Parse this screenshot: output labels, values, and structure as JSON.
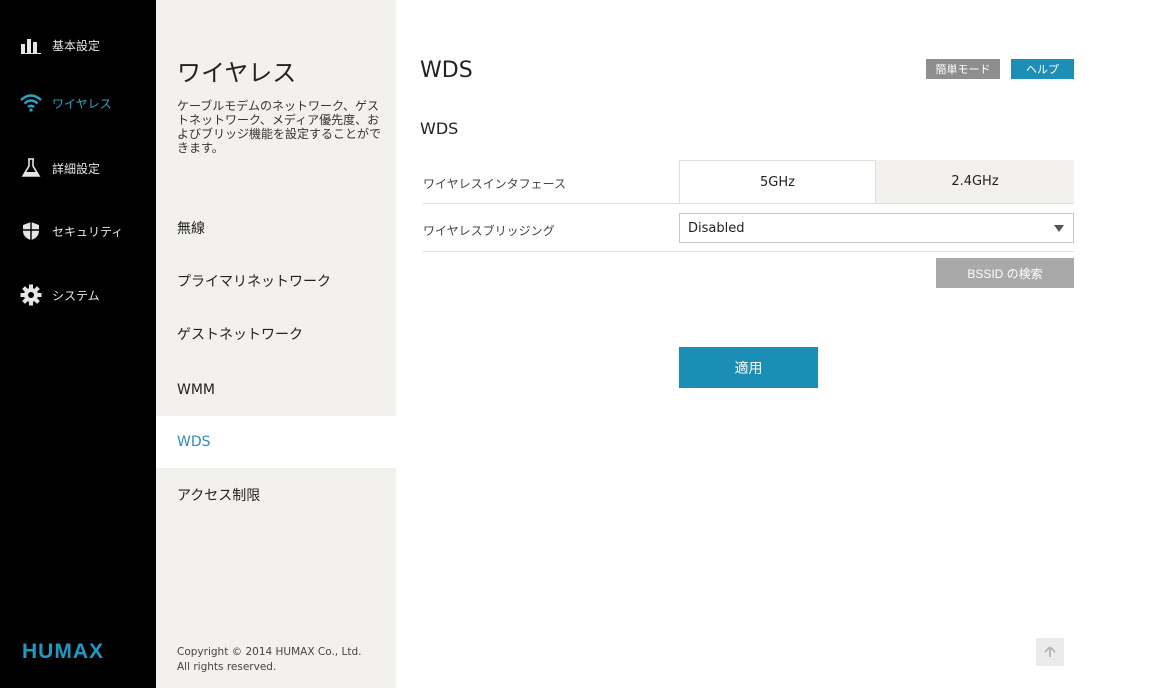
{
  "nav": {
    "items": [
      {
        "label": "基本設定",
        "icon": "bar-chart-icon",
        "active": false
      },
      {
        "label": "ワイヤレス",
        "icon": "wifi-icon",
        "active": true
      },
      {
        "label": "詳細設定",
        "icon": "flask-icon",
        "active": false
      },
      {
        "label": "セキュリティ",
        "icon": "shield-icon",
        "active": false
      },
      {
        "label": "システム",
        "icon": "gear-icon",
        "active": false
      }
    ],
    "logo": "HUMAX"
  },
  "submenu": {
    "title": "ワイヤレス",
    "description": "ケーブルモデムのネットワーク、ゲストネットワーク、メディア優先度、およびブリッジ機能を設定することができます。",
    "items": [
      {
        "label": "無線",
        "active": false
      },
      {
        "label": "プライマリネットワーク",
        "active": false
      },
      {
        "label": "ゲストネットワーク",
        "active": false
      },
      {
        "label": "WMM",
        "active": false
      },
      {
        "label": "WDS",
        "active": true
      },
      {
        "label": "アクセス制限",
        "active": false
      }
    ],
    "copyright_line1": "Copyright © 2014 HUMAX Co., Ltd.",
    "copyright_line2": "All rights reserved."
  },
  "main": {
    "title": "WDS",
    "simple_mode_label": "簡単モード",
    "help_label": "ヘルプ",
    "section_title": "WDS",
    "interface_label": "ワイヤレスインタフェース",
    "interface_options": [
      "5GHz",
      "2.4GHz"
    ],
    "interface_selected": "5GHz",
    "bridging_label": "ワイヤレスブリッジング",
    "bridging_value": "Disabled",
    "bssid_button": "BSSID の検索",
    "apply_button": "適用"
  },
  "colors": {
    "accent": "#1a8eb5",
    "active_nav": "#2aa3c9",
    "nav_bg": "#000000",
    "submenu_bg": "#f3f1ed"
  }
}
